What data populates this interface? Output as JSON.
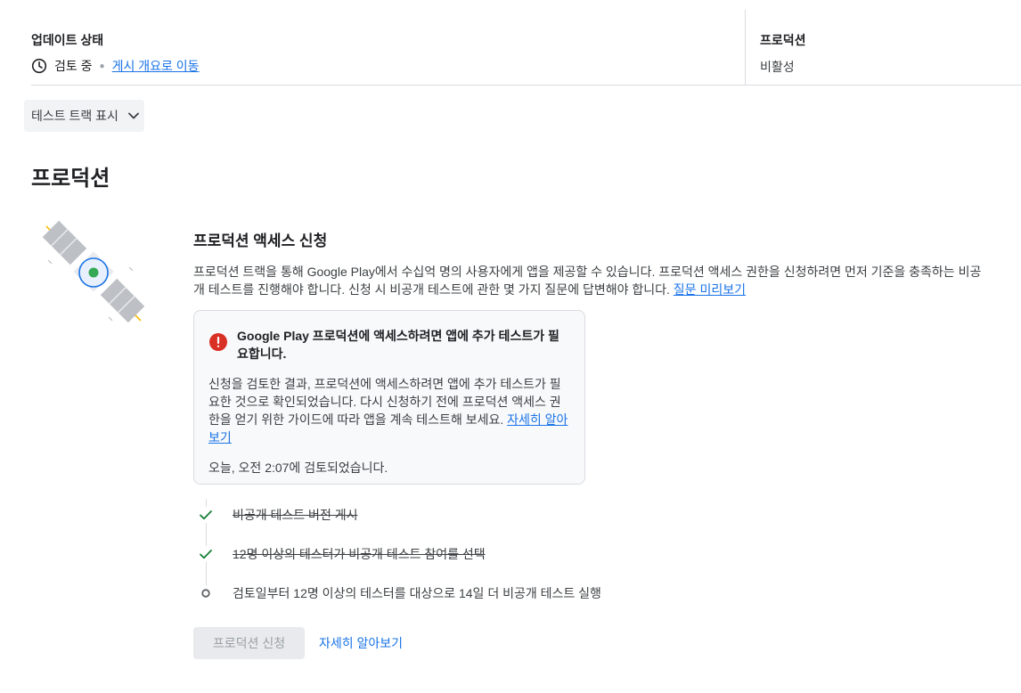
{
  "status": {
    "update_title": "업데이트 상태",
    "update_value": "검토 중",
    "overview_link": "게시 개요로 이동",
    "production_title": "프로덕션",
    "production_value": "비활성"
  },
  "track_toggle": {
    "label": "테스트 트랙 표시"
  },
  "page": {
    "title": "프로덕션"
  },
  "access": {
    "title": "프로덕션 액세스 신청",
    "description": "프로덕션 트랙을 통해 Google Play에서 수십억 명의 사용자에게 앱을 제공할 수 있습니다. 프로덕션 액세스 권한을 신청하려면 먼저 기준을 충족하는 비공개 테스트를 진행해야 합니다. 신청 시 비공개 테스트에 관한 몇 가지 질문에 답변해야 합니다.",
    "preview_link": "질문 미리보기"
  },
  "alert": {
    "title": "Google Play 프로덕션에 액세스하려면 앱에 추가 테스트가 필요합니다.",
    "body": "신청을 검토한 결과, 프로덕션에 액세스하려면 앱에 추가 테스트가 필요한 것으로 확인되었습니다. 다시 신청하기 전에 프로덕션 액세스 권한을 얻기 위한 가이드에 따라 앱을 계속 테스트해 보세요.",
    "learn_link": "자세히 알아보기",
    "reviewed_time": "오늘, 오전 2:07에 검토되었습니다."
  },
  "steps": [
    {
      "label": "비공개 테스트 버전 게시",
      "done": true
    },
    {
      "label": "12명 이상의 테스터가 비공개 테스트 참여를 선택",
      "done": true
    },
    {
      "label": "검토일부터 12명 이상의 테스터를 대상으로 14일 더 비공개 테스트 실행",
      "done": false
    }
  ],
  "actions": {
    "apply_button": "프로덕션 신청",
    "learn_more": "자세히 알아보기"
  },
  "colors": {
    "link": "#1a73e8",
    "error": "#d93025",
    "success": "#188038",
    "satellite_core": "#34a853"
  }
}
